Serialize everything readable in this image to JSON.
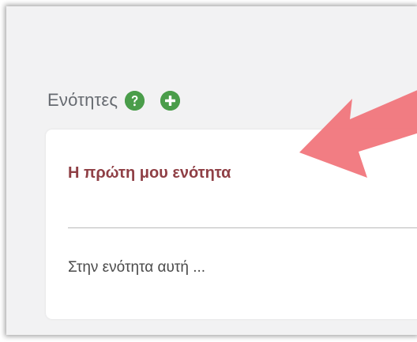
{
  "sections": {
    "title": "Ενότητες",
    "help_icon": "question-circle-icon",
    "add_icon": "plus-circle-icon",
    "accent_color": "#4a9d4a"
  },
  "section_card": {
    "title": "Η πρώτη μου ενότητα",
    "description": "Στην ενότητα αυτή ...",
    "title_color": "#8f3f45"
  },
  "annotation": {
    "arrow_color": "#f06b72"
  }
}
